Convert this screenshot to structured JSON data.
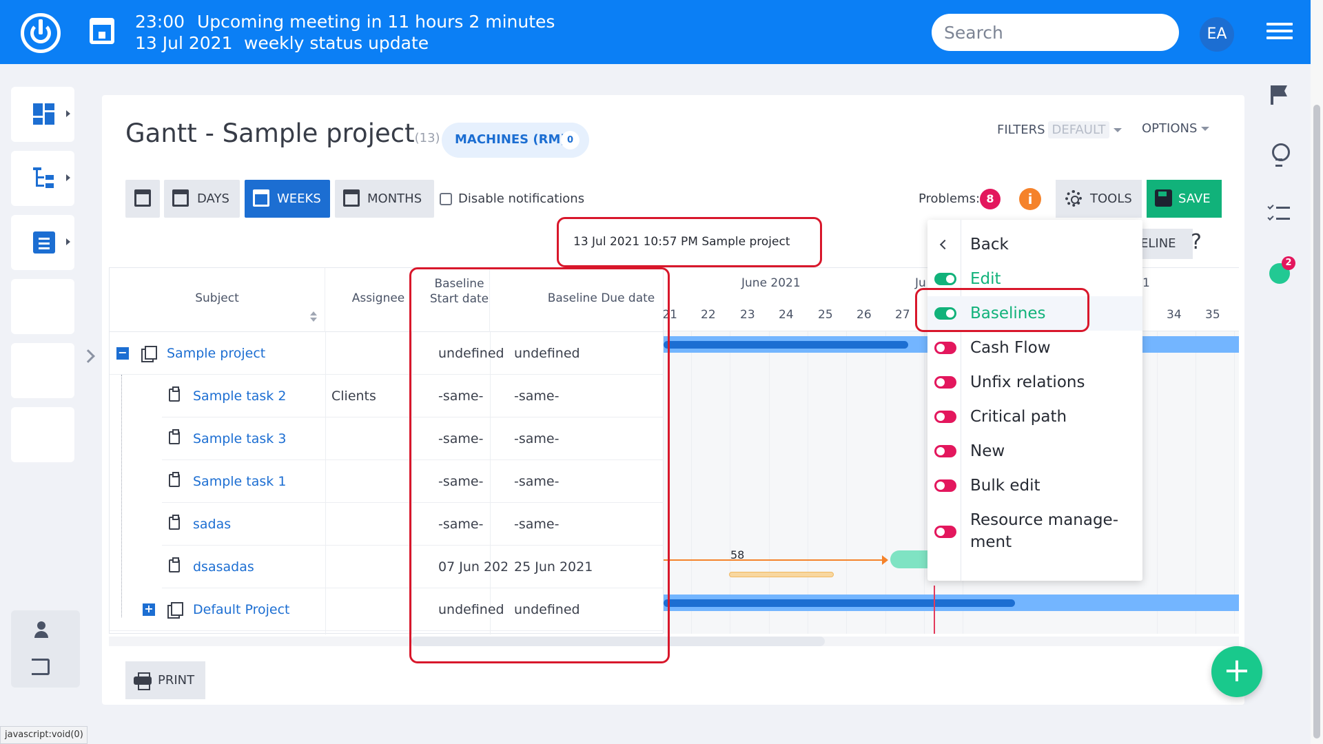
{
  "topbar": {
    "meeting_time": "23:00",
    "meeting_title": "Upcoming meeting in 11 hours 2 minutes",
    "meeting_date": "13 Jul 2021",
    "meeting_subject": "weekly status update",
    "search_placeholder": "Search",
    "avatar_initials": "EA",
    "brand_color": "#0b7ff5"
  },
  "page": {
    "title": "Gantt - Sample project",
    "title_count": "(13)",
    "machines_label": "MACHINES (RM)",
    "machines_count": "0",
    "filters_label": "FILTERS",
    "filters_value": "DEFAULT",
    "options_label": "OPTIONS"
  },
  "toolbar": {
    "days": "DAYS",
    "weeks": "WEEKS",
    "months": "MONTHS",
    "disable_notifications": "Disable notifications",
    "problems_label": "Problems:",
    "problems_count": "8",
    "info_icon": "i",
    "tools": "TOOLS",
    "save": "SAVE",
    "baseline_partial": "ELINE",
    "help": "?"
  },
  "baseline_header": "13 Jul 2021 10:57 PM Sample project",
  "grid": {
    "columns": [
      "Subject",
      "Assignee",
      "Baseline\nStart date",
      "Baseline Due date"
    ],
    "rows": [
      {
        "subject": "Sample project",
        "assignee": "",
        "start": "undefined",
        "due": "undefined",
        "type": "project",
        "toggle": "−"
      },
      {
        "subject": "Sample task 2",
        "assignee": "Clients",
        "start": "-same-",
        "due": "-same-",
        "type": "task"
      },
      {
        "subject": "Sample task 3",
        "assignee": "",
        "start": "-same-",
        "due": "-same-",
        "type": "task"
      },
      {
        "subject": "Sample task 1",
        "assignee": "",
        "start": "-same-",
        "due": "-same-",
        "type": "task"
      },
      {
        "subject": "sadas",
        "assignee": "",
        "start": "-same-",
        "due": "-same-",
        "type": "task"
      },
      {
        "subject": "dsasadas",
        "assignee": "",
        "start": "07 Jun 202",
        "due": "25 Jun 2021",
        "type": "task"
      },
      {
        "subject": "Default Project",
        "assignee": "",
        "start": "undefined",
        "due": "undefined",
        "type": "project",
        "toggle": "+"
      }
    ]
  },
  "chart": {
    "month_label": "June 2021",
    "month_label_partial": "Ju",
    "weeks_left": [
      "21",
      "22",
      "23",
      "24",
      "25",
      "26",
      "27"
    ],
    "weeks_right": [
      "34",
      "35"
    ],
    "right_partial_label": "1",
    "dependency_label": "58"
  },
  "menu": {
    "back": "Back",
    "items": [
      {
        "label": "Edit",
        "on": true
      },
      {
        "label": "Baselines",
        "on": true
      },
      {
        "label": "Cash Flow",
        "on": false
      },
      {
        "label": "Unfix relations",
        "on": false
      },
      {
        "label": "Critical path",
        "on": false
      },
      {
        "label": "New",
        "on": false
      },
      {
        "label": "Bulk edit",
        "on": false
      },
      {
        "label": "Resource manage-\nment",
        "on": false
      }
    ]
  },
  "footer": {
    "print": "PRINT",
    "fab": "+",
    "status_url": "javascript:void(0)"
  }
}
